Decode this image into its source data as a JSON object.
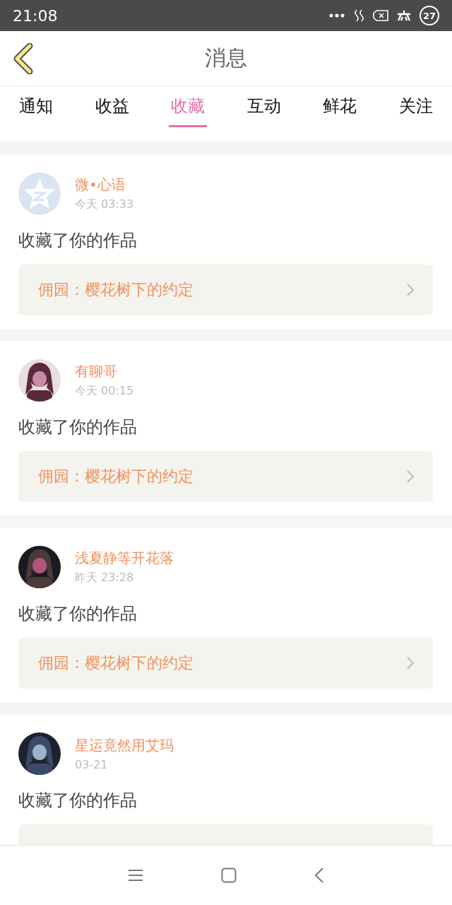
{
  "status_bar": {
    "time": "21:08",
    "battery": "27"
  },
  "header": {
    "title": "消息"
  },
  "tabs": [
    {
      "label": "通知",
      "selected": false
    },
    {
      "label": "收益",
      "selected": false
    },
    {
      "label": "收藏",
      "selected": true
    },
    {
      "label": "互动",
      "selected": false
    },
    {
      "label": "鲜花",
      "selected": false
    },
    {
      "label": "关注",
      "selected": false
    }
  ],
  "messages": [
    {
      "avatar": {
        "kind": "default"
      },
      "name": "微•心语",
      "time": "今天 03:33",
      "text": "收藏了你的作品",
      "work": "佣园：樱花树下的约定"
    },
    {
      "name": "有聊哥",
      "time": "今天 00:15",
      "text": "收藏了你的作品",
      "work": "佣园：樱花树下的约定"
    },
    {
      "name": "浅夏静等开花落",
      "time": "昨天 23:28",
      "text": "收藏了你的作品",
      "work": "佣园：樱花树下的约定"
    },
    {
      "name": "星运竟然用艾玛",
      "time": "03-21",
      "text": "收藏了你的作品"
    }
  ]
}
